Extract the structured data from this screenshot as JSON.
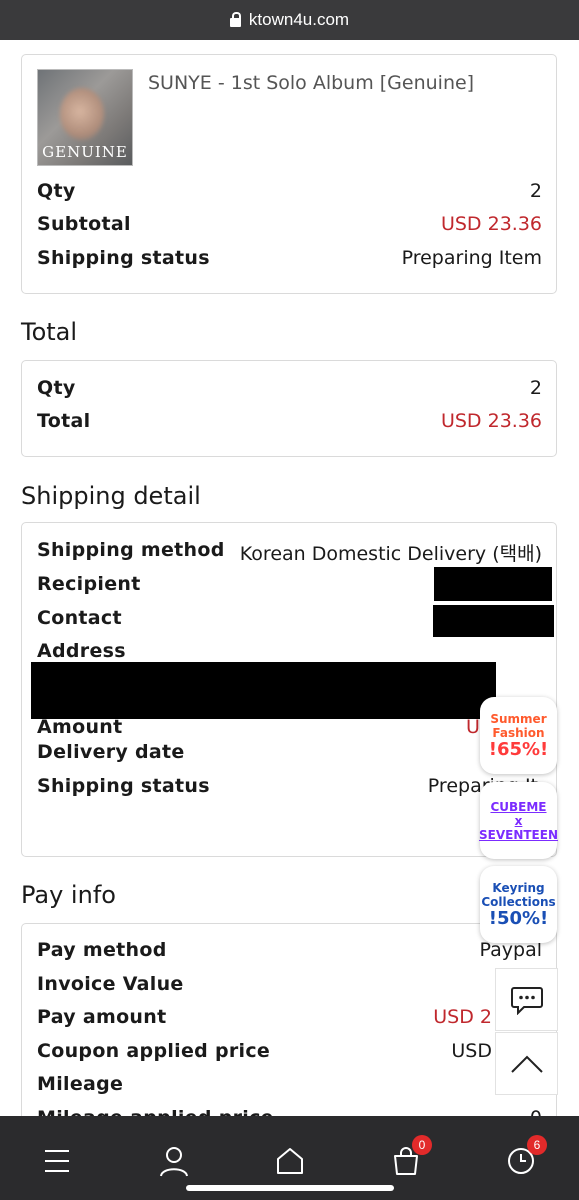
{
  "browser": {
    "url": "ktown4u.com"
  },
  "product": {
    "name": "SUNYE - 1st Solo Album [Genuine]",
    "cover_text": "GENUINE",
    "qty_label": "Qty",
    "qty": "2",
    "subtotal_label": "Subtotal",
    "subtotal": "USD 23.36",
    "status_label": "Shipping status",
    "status": "Preparing Item"
  },
  "total": {
    "title": "Total",
    "qty_label": "Qty",
    "qty": "2",
    "total_label": "Total",
    "total": "USD 23.36"
  },
  "shipping": {
    "title": "Shipping detail",
    "method_label": "Shipping method",
    "method": "Korean Domestic Delivery (택배)",
    "recipient_label": "Recipient",
    "contact_label": "Contact",
    "address_label": "Address",
    "amount_label": "Amount",
    "amount": "US",
    "delivery_date_label": "Delivery date",
    "status_label": "Shipping status",
    "status": "Preparing It"
  },
  "pay": {
    "title": "Pay info",
    "method_label": "Pay method",
    "method": "Paypal",
    "invoice_label": "Invoice Value",
    "amount_label": "Pay amount",
    "amount": "USD 2",
    "coupon_label": "Coupon applied price",
    "coupon": "USD",
    "mileage_label": "Mileage",
    "mileage_applied_label": "Mileage applied price",
    "mileage_applied": "0"
  },
  "promos": [
    {
      "line1": "Summer",
      "line2": "Fashion",
      "pct": "!65%!"
    },
    {
      "line1": "CUBEME",
      "line2": "x",
      "line3": "SEVENTEEN"
    },
    {
      "line1": "Keyring",
      "line2": "Collections",
      "pct": "!50%!"
    }
  ],
  "nav": {
    "cart_badge": "0",
    "recent_badge": "6"
  },
  "icons": [
    "lock-icon",
    "chat-icon",
    "chevron-up-icon",
    "menu-icon",
    "user-icon",
    "home-icon",
    "cart-icon",
    "clock-icon"
  ]
}
